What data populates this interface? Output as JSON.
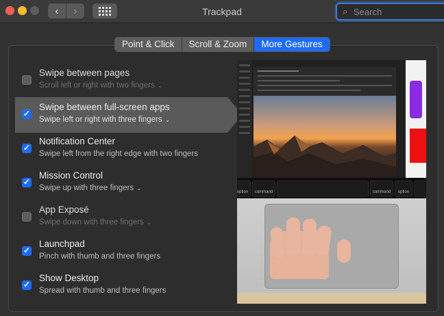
{
  "window": {
    "title": "Trackpad",
    "search_placeholder": "Search",
    "nav_back": "‹",
    "nav_forward": "›"
  },
  "tabs": [
    {
      "label": "Point & Click",
      "active": false
    },
    {
      "label": "Scroll & Zoom",
      "active": false
    },
    {
      "label": "More Gestures",
      "active": true
    }
  ],
  "gestures": [
    {
      "title": "Swipe between pages",
      "subtitle": "Scroll left or right with two fingers",
      "checked": false,
      "has_menu": true,
      "selected": false,
      "dim": true
    },
    {
      "title": "Swipe between full-screen apps",
      "subtitle": "Swipe left or right with three fingers",
      "checked": true,
      "has_menu": true,
      "selected": true,
      "dim": false
    },
    {
      "title": "Notification Center",
      "subtitle": "Swipe left from the right edge with two fingers",
      "checked": true,
      "has_menu": false,
      "selected": false,
      "dim": false
    },
    {
      "title": "Mission Control",
      "subtitle": "Swipe up with three fingers",
      "checked": true,
      "has_menu": true,
      "selected": false,
      "dim": false
    },
    {
      "title": "App Exposé",
      "subtitle": "Swipe down with three fingers",
      "checked": false,
      "has_menu": true,
      "selected": false,
      "dim": true
    },
    {
      "title": "Launchpad",
      "subtitle": "Pinch with thumb and three fingers",
      "checked": true,
      "has_menu": false,
      "selected": false,
      "dim": false
    },
    {
      "title": "Show Desktop",
      "subtitle": "Spread with thumb and three fingers",
      "checked": true,
      "has_menu": false,
      "selected": false,
      "dim": false
    }
  ],
  "keyboard": {
    "left_keys": [
      "option",
      "command"
    ],
    "right_keys": [
      "command",
      "option"
    ]
  },
  "colors": {
    "accent": "#1f6bf5",
    "selected_row": "#5a5a5a"
  }
}
